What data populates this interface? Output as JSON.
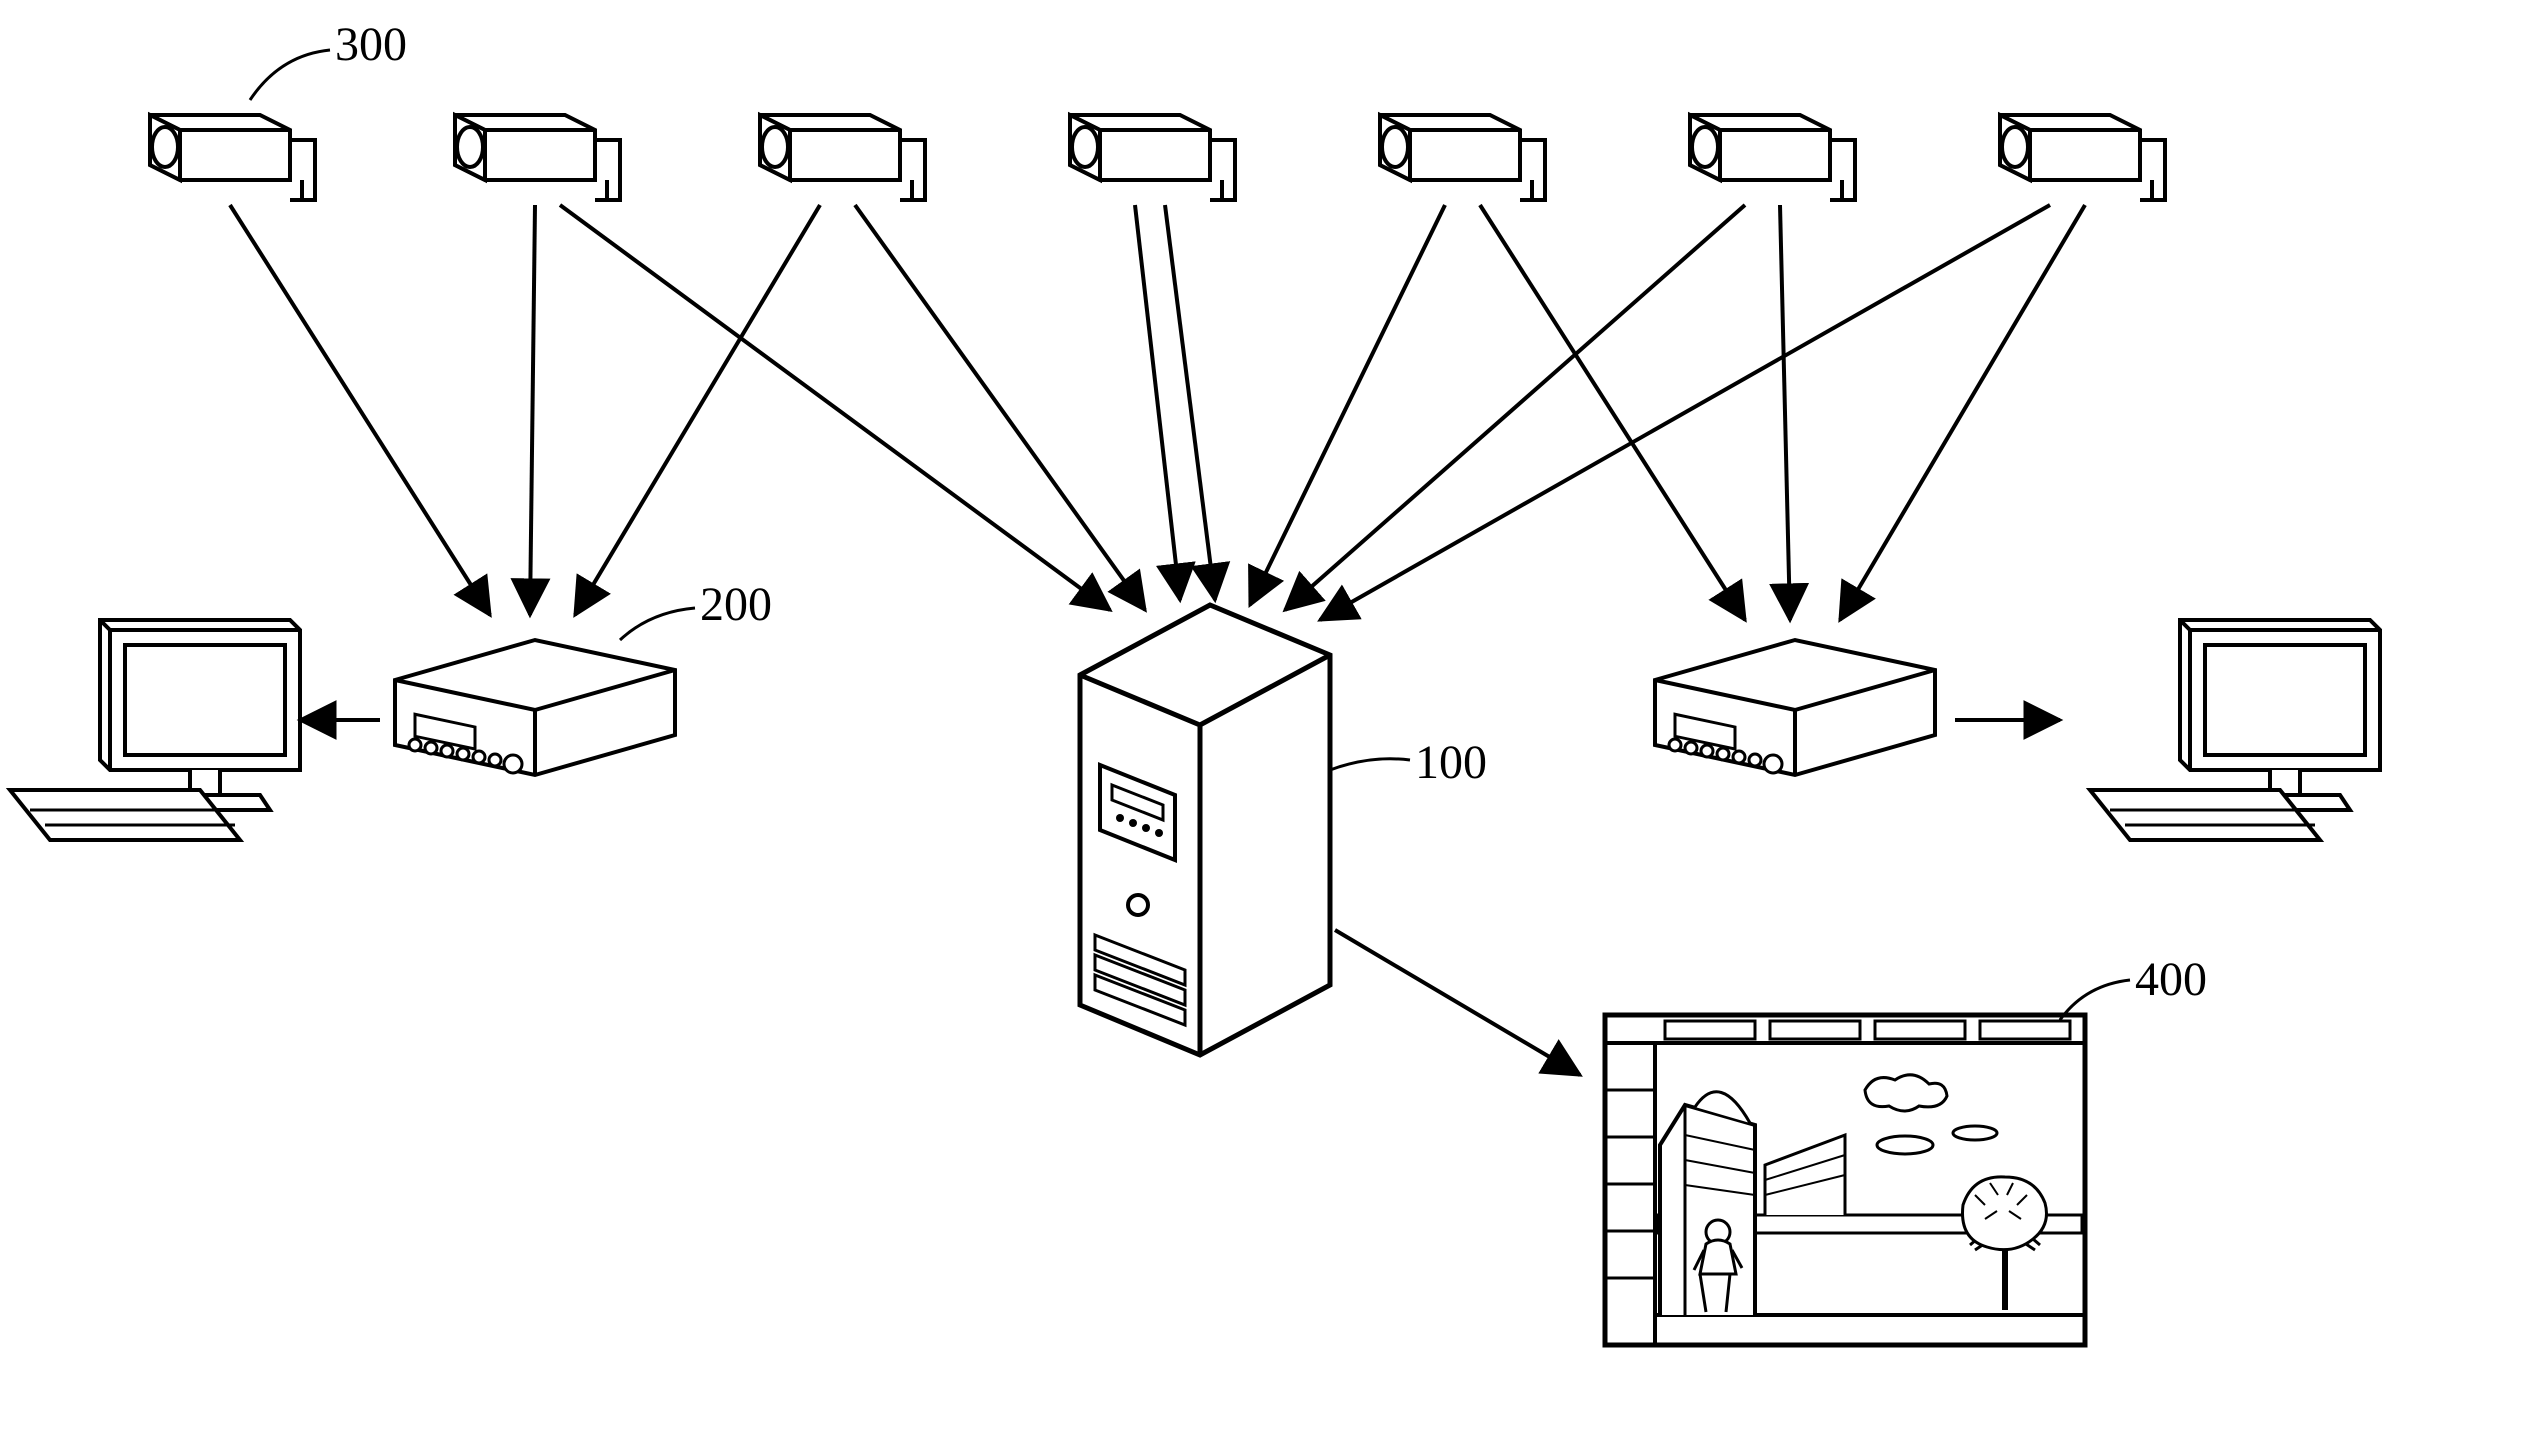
{
  "labels": {
    "camera": "300",
    "recorder": "200",
    "server": "100",
    "display": "400"
  },
  "components": {
    "cameras_count": 7,
    "recorders_count": 2,
    "computers_count": 2,
    "server_count": 1,
    "display_count": 1
  }
}
